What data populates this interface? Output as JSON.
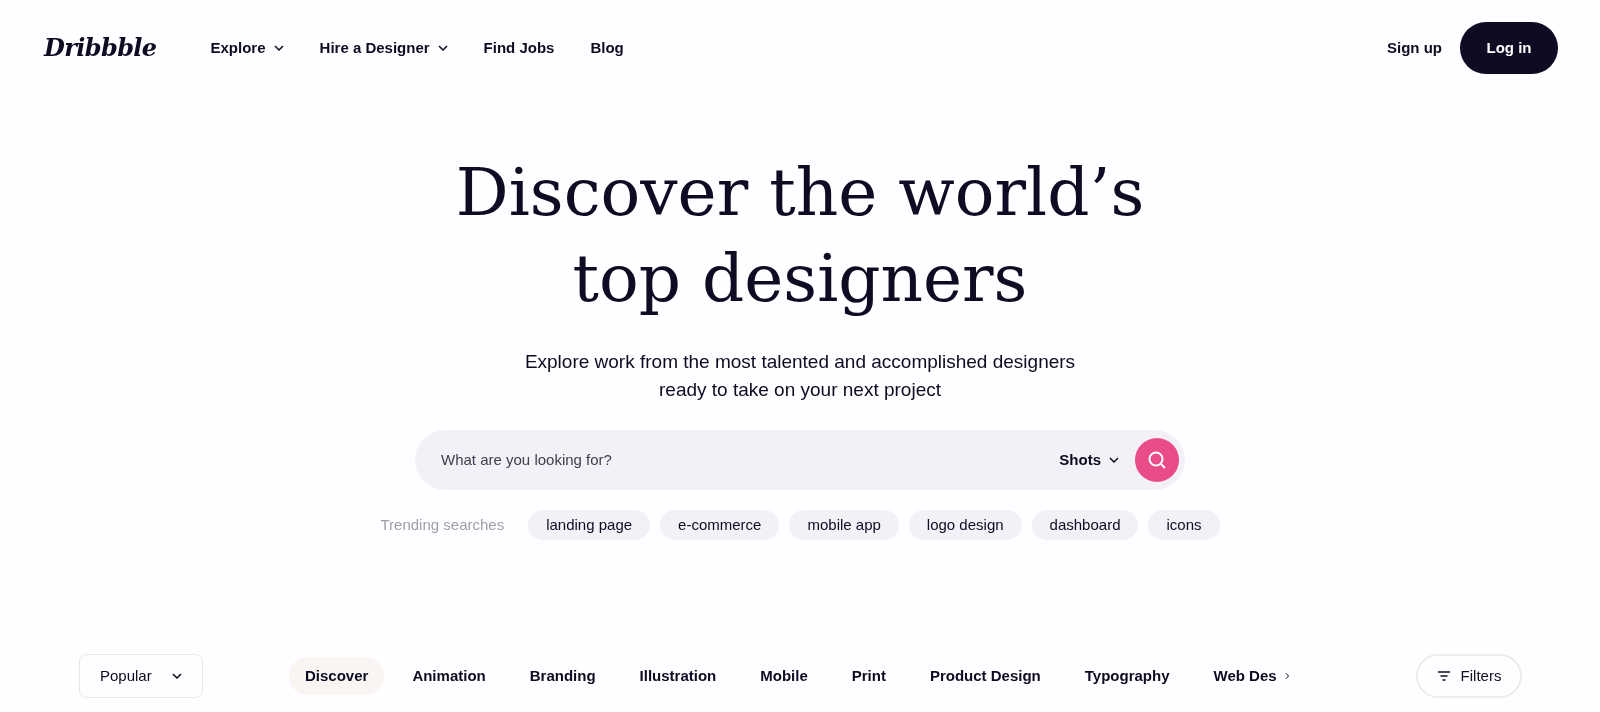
{
  "header": {
    "logo": "Dribbble",
    "nav": [
      {
        "label": "Explore",
        "dropdown": true
      },
      {
        "label": "Hire a Designer",
        "dropdown": true
      },
      {
        "label": "Find Jobs",
        "dropdown": false
      },
      {
        "label": "Blog",
        "dropdown": false
      }
    ],
    "signup": "Sign up",
    "login": "Log in"
  },
  "hero": {
    "title_lines": [
      "Discover the world’s",
      "top designers"
    ],
    "subtitle_lines": [
      "Explore work from the most talented and accomplished designers",
      "ready to take on your next project"
    ]
  },
  "search": {
    "placeholder": "What are you looking for?",
    "scope": "Shots"
  },
  "trending": {
    "label": "Trending searches",
    "tags": [
      "landing page",
      "e-commerce",
      "mobile app",
      "logo design",
      "dashboard",
      "icons"
    ]
  },
  "filter_bar": {
    "sort": "Popular",
    "categories": [
      {
        "label": "Discover",
        "selected": true
      },
      {
        "label": "Animation",
        "selected": false
      },
      {
        "label": "Branding",
        "selected": false
      },
      {
        "label": "Illustration",
        "selected": false
      },
      {
        "label": "Mobile",
        "selected": false
      },
      {
        "label": "Print",
        "selected": false
      },
      {
        "label": "Product Design",
        "selected": false
      },
      {
        "label": "Typography",
        "selected": false
      },
      {
        "label": "Web Des",
        "selected": false
      }
    ],
    "filters": "Filters"
  }
}
